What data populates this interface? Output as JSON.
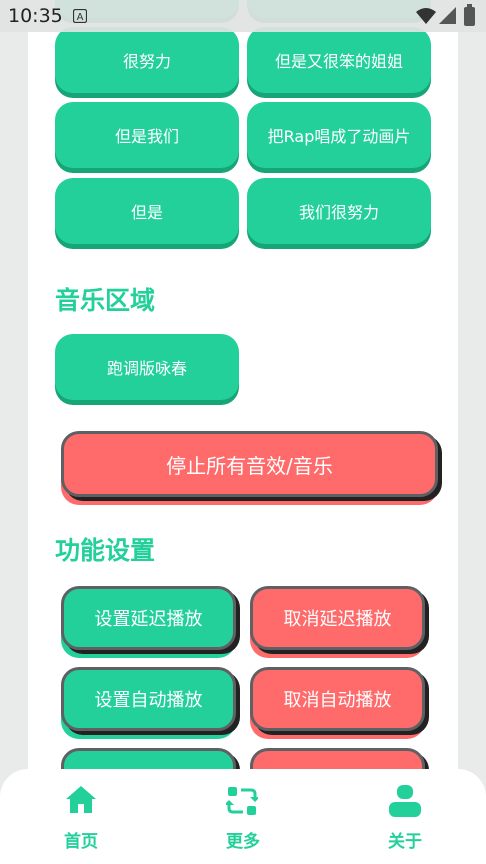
{
  "status_bar": {
    "time": "10:35"
  },
  "sound_buttons": [
    "很努力",
    "但是又很笨的姐姐",
    "但是我们",
    "把Rap唱成了动画片",
    "但是",
    "我们很努力"
  ],
  "music_section": {
    "title": "音乐区域",
    "button": "跑调版咏春"
  },
  "stop_all": "停止所有音效/音乐",
  "settings_section": {
    "title": "功能设置",
    "set_delay": "设置延迟播放",
    "cancel_delay": "取消延迟播放",
    "set_auto": "设置自动播放",
    "cancel_auto": "取消自动播放"
  },
  "bottom_nav": {
    "home": "首页",
    "more": "更多",
    "about": "关于"
  },
  "colors": {
    "accent": "#24d09a",
    "danger": "#ff6b6b"
  },
  "icons": [
    "notification-a-icon",
    "wifi-icon",
    "signal-icon",
    "battery-icon",
    "home-icon",
    "swap-icon",
    "person-icon"
  ]
}
